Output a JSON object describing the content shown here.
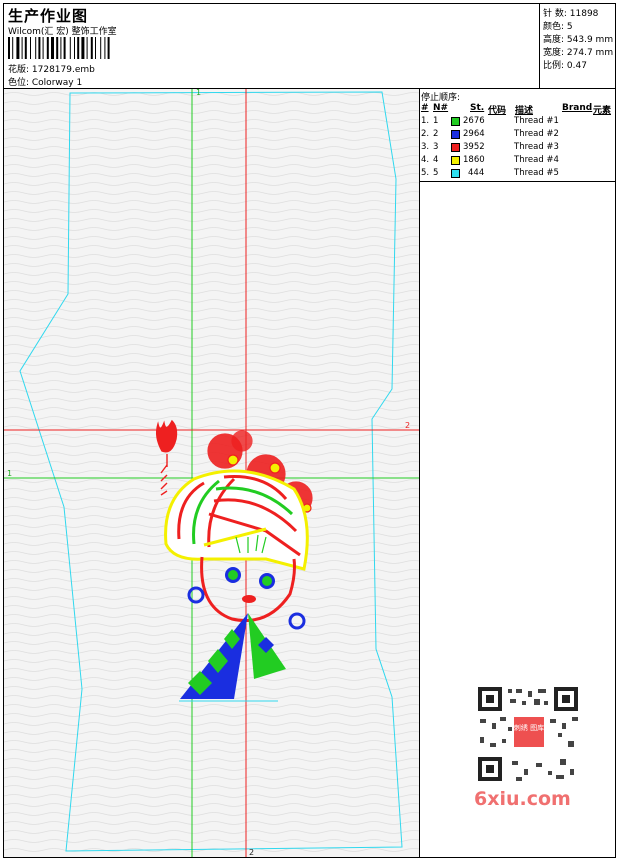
{
  "header": {
    "title": "生产作业图",
    "company": "Wilcom(汇 宏) 整饰工作室",
    "design_file": "花版:  1728179.emb",
    "colorway": "色位:  Colorway 1"
  },
  "stats": [
    {
      "label": "针 数:",
      "value": "11898"
    },
    {
      "label": "颜色:",
      "value": "5"
    },
    {
      "label": "高度:",
      "value": "543.9 mm"
    },
    {
      "label": "宽度:",
      "value": "274.7 mm"
    },
    {
      "label": "比例:",
      "value": "0.47"
    }
  ],
  "stop_sequence": {
    "title": "停止顺序:",
    "headers": {
      "hash": "#",
      "n": "N#",
      "st": "St.",
      "code": "代码",
      "desc": "描述",
      "brand": "Brand",
      "element": "元素"
    },
    "rows": [
      {
        "index": "1.",
        "n": "1",
        "color": "#22cc22",
        "code": "2676",
        "desc": "Thread #1"
      },
      {
        "index": "2.",
        "n": "2",
        "color": "#1a2ee0",
        "code": "2964",
        "desc": "Thread #2"
      },
      {
        "index": "3.",
        "n": "3",
        "color": "#ee2020",
        "code": "3952",
        "desc": "Thread #3"
      },
      {
        "index": "4.",
        "n": "4",
        "color": "#f4f000",
        "code": "1860",
        "desc": "Thread #4"
      },
      {
        "index": "5.",
        "n": "5",
        "color": "#30e0f0",
        "code": "444",
        "desc": "Thread #5"
      }
    ]
  },
  "guides": {
    "green_vertical_label": "1",
    "green_horizontal_label": "1",
    "red_horizontal_label": "2",
    "red_vertical_label": "2"
  },
  "watermark": {
    "text": "6xiu.com",
    "qr_badge": "刺绣 图库"
  },
  "colors": {
    "green": "#22cc22",
    "red": "#ee2020",
    "cyan": "#30d8ee",
    "blue": "#1a2ee0",
    "yellow": "#f4f000"
  }
}
